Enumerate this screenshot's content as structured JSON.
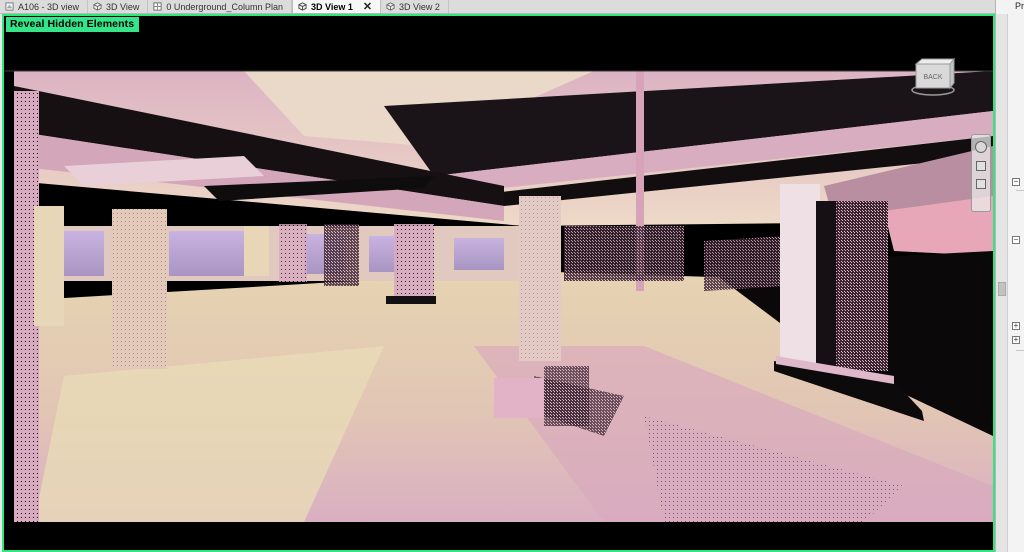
{
  "tabs": [
    {
      "label": "A106 - 3D view",
      "icon": "revit-view-icon",
      "active": false
    },
    {
      "label": "3D View",
      "icon": "3d-view-icon",
      "active": false
    },
    {
      "label": "0 Underground_Column Plan",
      "icon": "floor-plan-icon",
      "active": false
    },
    {
      "label": "3D View 1",
      "icon": "3d-view-icon",
      "active": true
    },
    {
      "label": "3D View 2",
      "icon": "3d-view-icon",
      "active": false
    }
  ],
  "tab_close_glyph": "✕",
  "tab_overflow_glyph": "▾",
  "viewport": {
    "reveal_hidden_label": "Reveal Hidden Elements",
    "frame_color": "#2ee87c",
    "viewcube_label": "BACK"
  },
  "properties_panel": {
    "label": "Pro",
    "tree_expanders": [
      "−",
      "−",
      "+",
      "+"
    ]
  },
  "colors": {
    "point_cloud_pink": "#d9a8bf",
    "point_cloud_cream": "#e8d7b4",
    "background": "#000000"
  }
}
